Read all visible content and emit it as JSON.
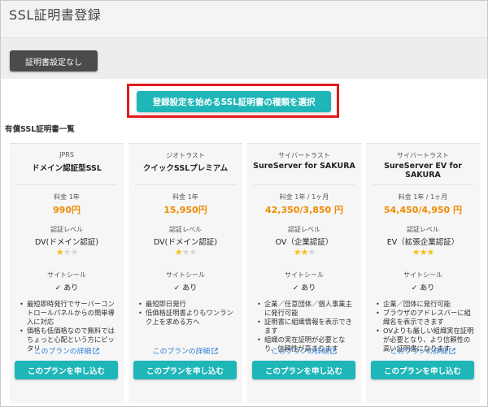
{
  "page": {
    "title": "SSL証明書登録",
    "no_setting_label": "証明書設定なし",
    "start_button_label": "登録設定を始めるSSL証明書の種類を選択",
    "section_title": "有償SSL証明書一覧"
  },
  "colors": {
    "accent": "#1fb6b8",
    "price": "#f08a00",
    "highlight_border": "#e01b1b",
    "star_on": "#f3c21a",
    "link": "#2d7fd3"
  },
  "labels": {
    "price_label_plans": [
      "料金 1年",
      "料金 1年",
      "料金 1年 / 1ヶ月",
      "料金 1年 / 1ヶ月"
    ],
    "level_label": "認証レベル",
    "seal_label": "サイトシール",
    "detail_link": "このプランの詳細",
    "apply_button": "このプランを申し込む"
  },
  "cards": [
    {
      "vendor": "JPRS",
      "name": "ドメイン認証型SSL",
      "price_label": "料金 1年",
      "price": "990円",
      "level": "DV(ドメイン認証)",
      "stars": 1,
      "seal": "✓ あり",
      "features": [
        "最短即時発行でサーバーコントロールパネルからの簡単導入に対応",
        "価格も低価格なので無料ではちょっと心配という方にピッタリ"
      ],
      "detail": "このプランの詳細",
      "apply": "このプランを申し込む"
    },
    {
      "vendor": "ジオトラスト",
      "name": "クイックSSLプレミアム",
      "price_label": "料金 1年",
      "price": "15,950円",
      "level": "DV(ドメイン認証)",
      "stars": 1,
      "seal": "✓ あり",
      "features": [
        "最短即日発行",
        "低価格証明書よりもワンランク上を求める方へ"
      ],
      "detail": "このプランの詳細",
      "apply": "このプランを申し込む"
    },
    {
      "vendor": "サイバートラスト",
      "name": "SureServer for SAKURA",
      "price_label": "料金 1年 / 1ヶ月",
      "price": "42,350/3,850 円",
      "level": "OV（企業認証）",
      "stars": 2,
      "seal": "✓ あり",
      "features": [
        "企業／任意団体／個人事業主に発行可能",
        "証明書に組織情報を表示できます",
        "組織の実在証明が必要となり、信頼性が高まります"
      ],
      "detail": "このプランの詳細",
      "apply": "このプランを申し込む"
    },
    {
      "vendor": "サイバートラスト",
      "name": "SureServer EV for SAKURA",
      "price_label": "料金 1年 / 1ヶ月",
      "price": "54,450/4,950 円",
      "level": "EV（拡張企業認証）",
      "stars": 3,
      "seal": "✓ あり",
      "features": [
        "企業／団体に発行可能",
        "ブラウザのアドレスバーに組織名を表示できます",
        "OVよりも厳しい組織実在証明が必要となり、より信頼性の高い証明書になります"
      ],
      "detail": "このプランの詳細",
      "apply": "このプランを申し込む"
    }
  ]
}
